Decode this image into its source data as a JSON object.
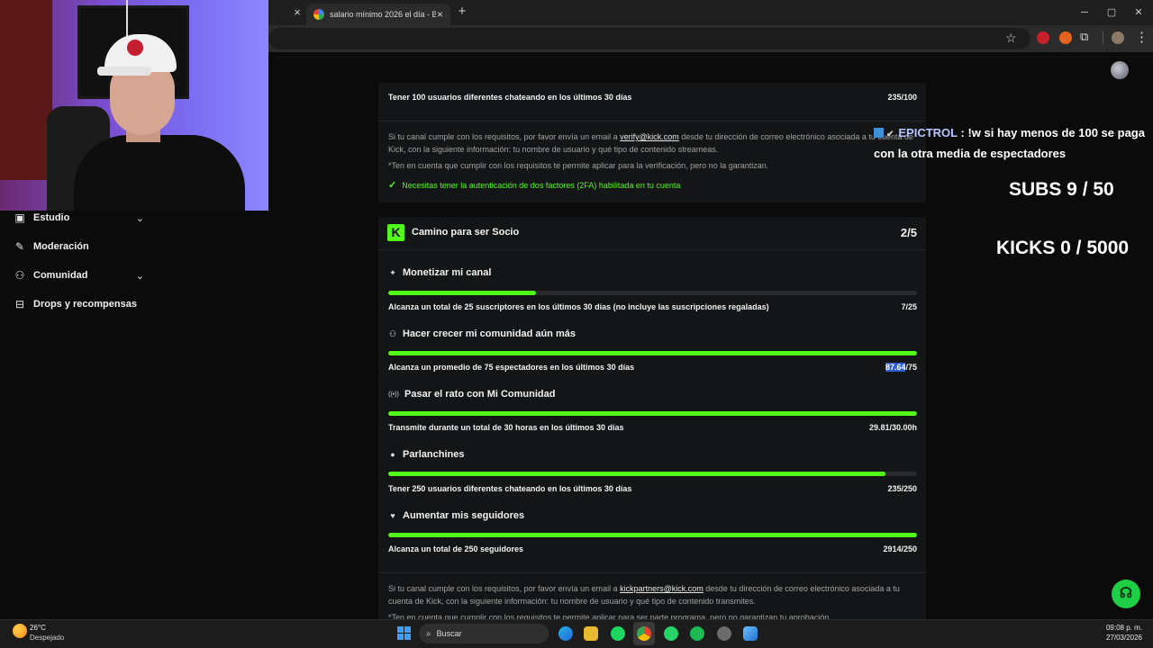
{
  "browser": {
    "tab_title": "salario mínimo 2026 el día - Bu",
    "tab_close": "×",
    "new_tab": "+",
    "minimize": "─",
    "maximize": "▢",
    "close": "✕"
  },
  "sidebar": {
    "items": [
      {
        "label": "Estudio",
        "icon": "studio-icon",
        "has_chevron": true
      },
      {
        "label": "Moderación",
        "icon": "wrench-icon",
        "has_chevron": false
      },
      {
        "label": "Comunidad",
        "icon": "people-icon",
        "has_chevron": true
      },
      {
        "label": "Drops y recompensas",
        "icon": "drops-icon",
        "has_chevron": false
      }
    ]
  },
  "verification": {
    "top_requirement": {
      "label": "Tener 100 usuarios diferentes chateando en los últimos 30 días",
      "value": "235/100"
    },
    "note_pre": "Si tu canal cumple con los requisitos, por favor envía un email a ",
    "note_email": "verify@kick.com",
    "note_post": " desde tu dirección de correo electrónico asociada a tu cuenta de Kick, con la siguiente información: tu nombre de usuario y qué tipo de contenido streameas.",
    "disclaimer": "*Ten en cuenta que cumplir con los requisitos te permite aplicar para la verificación, pero no la garantizan.",
    "twofa": "Necesitas tener la autenticación de dos factores (2FA) habilitada en tu cuenta"
  },
  "partner": {
    "logo": "K",
    "title": "Camino para ser Socio",
    "count": "2/5",
    "sections": [
      {
        "title": "Monetizar mi canal",
        "icon": "sparkle-icon",
        "glyph": "✦",
        "progress": 0.28,
        "requirement": "Alcanza un total de 25 suscriptores en los últimos 30 días (no incluye las suscripciones regaladas)",
        "value": "7/25"
      },
      {
        "title": "Hacer crecer mi comunidad aún más",
        "icon": "community-icon",
        "glyph": "⚇",
        "progress": 1.0,
        "requirement": "Alcanza un promedio de 75 espectadores en los últimos 30 días",
        "value_sel": "87.64",
        "value_rest": "/75"
      },
      {
        "title": "Pasar el rato con Mi Comunidad",
        "icon": "broadcast-icon",
        "glyph": "((•))",
        "progress": 1.0,
        "requirement": "Transmite durante un total de 30 horas en los últimos 30 días",
        "value": "29.81/30.00h"
      },
      {
        "title": "Parlanchines",
        "icon": "chat-bubble-icon",
        "glyph": "●",
        "progress": 0.94,
        "requirement": "Tener 250 usuarios diferentes chateando en los últimos 30 días",
        "value": "235/250"
      },
      {
        "title": "Aumentar mis seguidores",
        "icon": "heart-icon",
        "glyph": "♥",
        "progress": 1.0,
        "requirement": "Alcanza un total de 250 seguidores",
        "value": "2914/250"
      }
    ],
    "note_pre": "Si tu canal cumple con los requisitos, por favor envía un email a ",
    "note_email": "kickpartners@kick.com",
    "note_post": " desde tu dirección de correo electrónico asociada a tu cuenta de Kick, con la siguiente información: tu nombre de usuario y qué tipo de contenido transmites.",
    "disclaimer": "*Ten en cuenta que cumplir con los requisitos te permite aplicar para ser parte programa, pero no garantizan tu aprobación."
  },
  "overlay": {
    "chat_user": "EPICTROL",
    "chat_message": " : !w si hay menos de 100 se paga con la otra media de espectadores",
    "subs_goal": "SUBS 9 / 50",
    "kicks_goal": "KICKS 0 / 5000"
  },
  "taskbar": {
    "temperature": "26°C",
    "weather": "Despejado",
    "search_placeholder": "Buscar",
    "time": "09:08 p. m.",
    "date": "27/03/2026"
  },
  "colors": {
    "accent": "#53fc18",
    "background": "#0b0b0c",
    "card": "#141516"
  }
}
